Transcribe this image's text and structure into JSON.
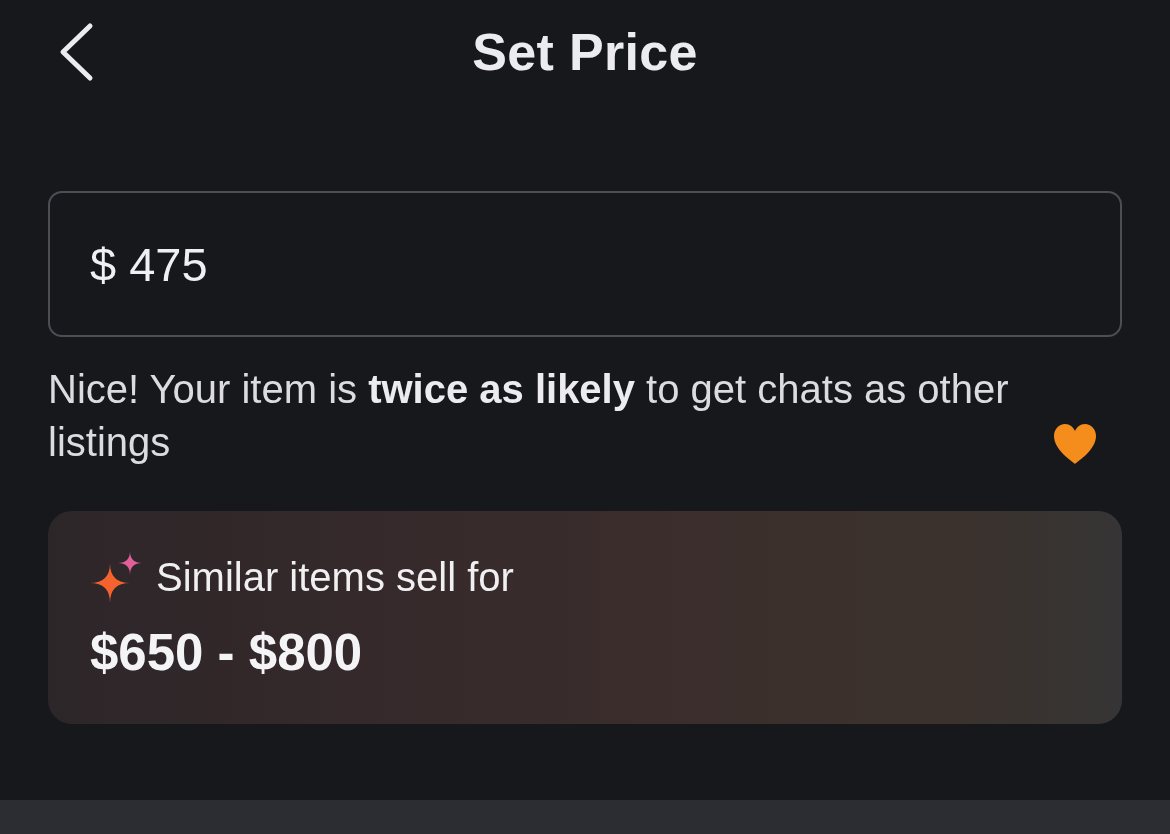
{
  "header": {
    "title": "Set Price"
  },
  "price_field": {
    "value": "$ 475"
  },
  "feedback": "Nice! Your item is **twice as likely** to get chats as other listings",
  "suggestion_card": {
    "label": "Similar items sell for",
    "range": "$650 - $800"
  }
}
